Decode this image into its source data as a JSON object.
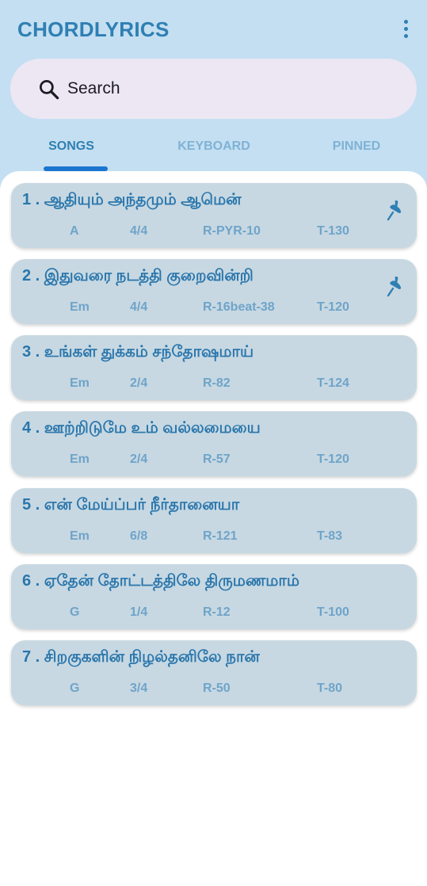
{
  "app": {
    "title": "CHORDLYRICS",
    "menu_icon": "more-vert-icon"
  },
  "search": {
    "placeholder": "Search",
    "icon": "search-icon"
  },
  "tabs": [
    {
      "label": "SONGS",
      "active": true
    },
    {
      "label": "KEYBOARD",
      "active": false
    },
    {
      "label": "PINNED",
      "active": false
    }
  ],
  "colors": {
    "header_bg": "#c4dff1",
    "accent": "#2f7fb3",
    "tab_indicator": "#1a76cf",
    "card_bg": "#c7d8e2",
    "meta_text": "#6fa4c9"
  },
  "songs": [
    {
      "title": "1 . ஆதியும் அந்தமும் ஆமென்",
      "key": "A",
      "time": "4/4",
      "rhythm": "R-PYR-10",
      "tempo": "T-130",
      "pinned": true
    },
    {
      "title": "2 . இதுவரை நடத்தி குறைவின்றி",
      "key": "Em",
      "time": "4/4",
      "rhythm": "R-16beat-38",
      "tempo": "T-120",
      "pinned": true
    },
    {
      "title": "3 . உங்கள் துக்கம் சந்தோஷமாய்",
      "key": "Em",
      "time": "2/4",
      "rhythm": "R-82",
      "tempo": "T-124",
      "pinned": false
    },
    {
      "title": "4 . ஊற்றிடுமே உம் வல்லமையை",
      "key": "Em",
      "time": "2/4",
      "rhythm": "R-57",
      "tempo": "T-120",
      "pinned": false
    },
    {
      "title": "5 . என் மேய்ப்பர் நீர்தானையா",
      "key": "Em",
      "time": "6/8",
      "rhythm": "R-121",
      "tempo": "T-83",
      "pinned": false
    },
    {
      "title": "6 . ஏதேன் தோட்டத்திலே திருமணமாம்",
      "key": "G",
      "time": "1/4",
      "rhythm": "R-12",
      "tempo": "T-100",
      "pinned": false
    },
    {
      "title": "7 . சிறகுகளின் நிழல்தனிலே நான்",
      "key": "G",
      "time": "3/4",
      "rhythm": "R-50",
      "tempo": "T-80",
      "pinned": false
    }
  ]
}
